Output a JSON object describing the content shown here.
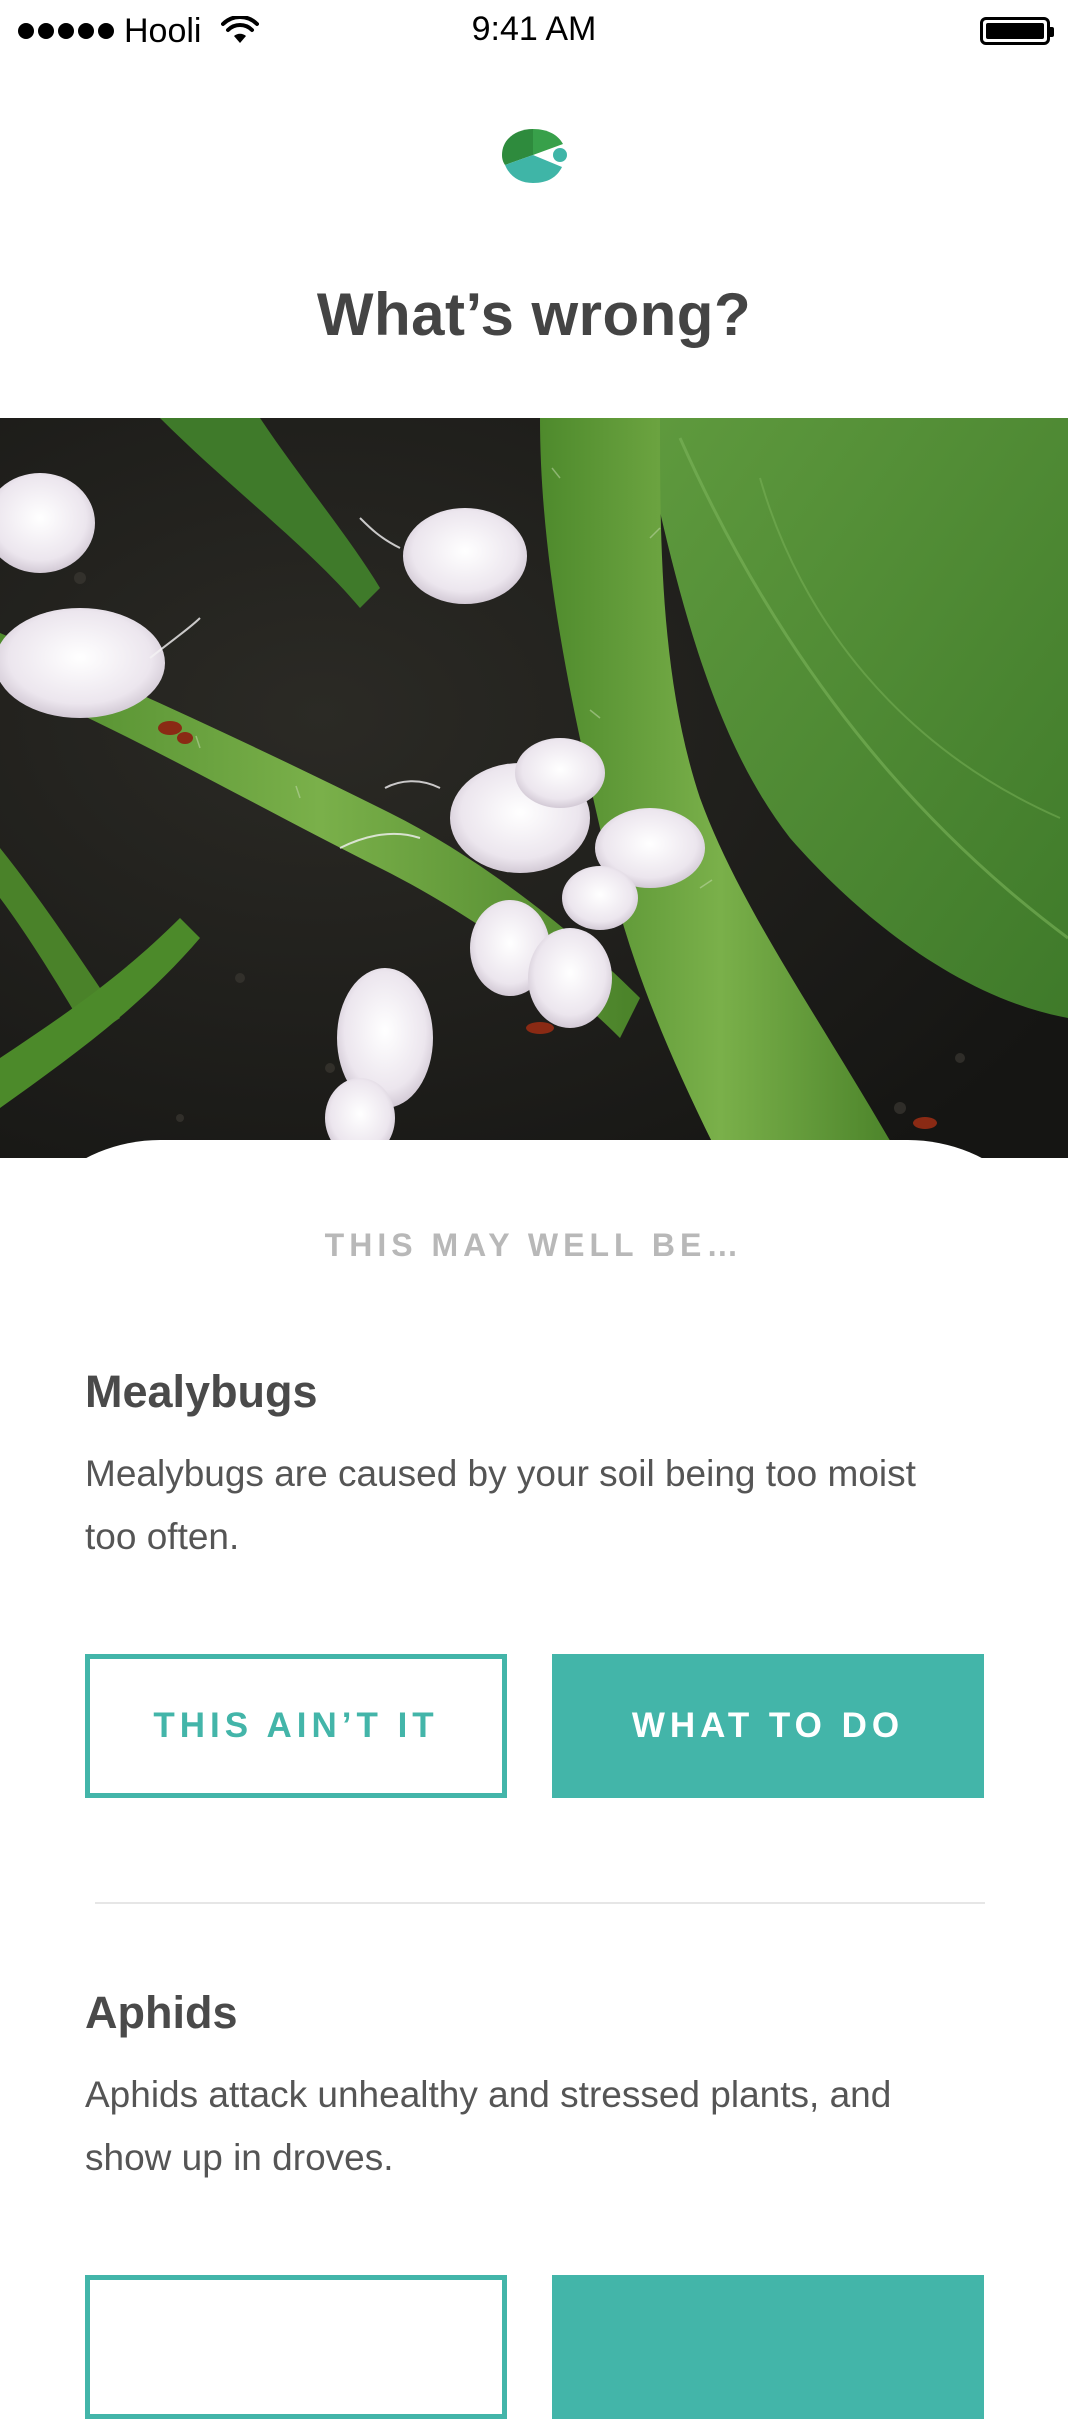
{
  "status_bar": {
    "carrier": "Hooli",
    "time": "9:41 AM",
    "signal_icon": "signal-dots-icon",
    "wifi_icon": "wifi-icon",
    "battery_icon": "battery-icon"
  },
  "header": {
    "logo_icon": "app-logo-icon",
    "title": "What’s wrong?"
  },
  "photo": {
    "subject_icon": "plant-photo"
  },
  "results": {
    "section_label": "THIS MAY WELL BE…",
    "items": [
      {
        "title": "Mealybugs",
        "description": "Mealybugs are caused by your soil being too moist too often.",
        "dismiss_label": "THIS AIN’T IT",
        "action_label": "WHAT TO DO"
      },
      {
        "title": "Aphids",
        "description": "Aphids attack unhealthy and stressed plants, and show up in droves.",
        "dismiss_label": "",
        "action_label": ""
      }
    ]
  },
  "colors": {
    "accent": "#43b5a9",
    "logo_dark": "#2e8b3d",
    "logo_light": "#3fb5a7",
    "title_text": "#444444",
    "muted_label": "#b8b8b8"
  }
}
